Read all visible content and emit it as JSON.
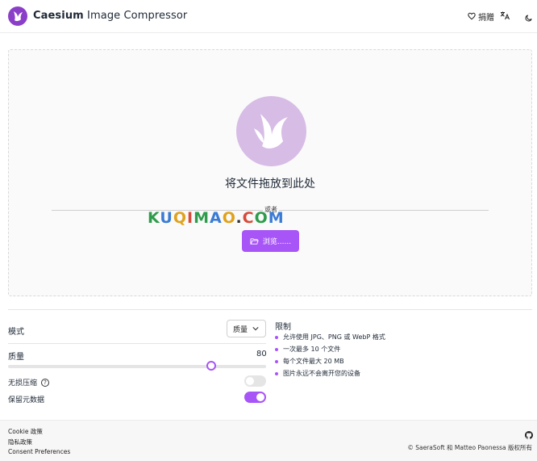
{
  "header": {
    "app_name_bold": "Caesium",
    "app_name_rest": " Image Compressor",
    "logo_icon": "caesium-bird-logo",
    "donate_label": "捐赠",
    "language_icon": "translate-icon",
    "theme_icon": "moon-icon"
  },
  "dropzone": {
    "title": "将文件拖放到此处",
    "or_text": "或者",
    "browse_label": "浏览......",
    "watermark": "KUQIMAO.COM"
  },
  "settings": {
    "mode_label": "模式",
    "mode_value": "质量",
    "quality_label": "质量",
    "quality_value": 80,
    "quality_value_text": "80",
    "lossless_label": "无损压缩",
    "lossless_enabled": false,
    "keep_metadata_label": "保留元数据",
    "keep_metadata_enabled": true
  },
  "limits": {
    "title": "限制",
    "items": [
      "允许使用 JPG、PNG 或 WebP 格式",
      "一次最多 10 个文件",
      "每个文件最大 20 MB",
      "图片永远不会离开您的设备"
    ]
  },
  "footer": {
    "cookie_policy": "Cookie 政策",
    "privacy_policy": "隐私政策",
    "consent_preferences": "Consent Preferences",
    "copyright": "© SaeraSoft 和 Matteo Paonessa 版权所有",
    "github_icon": "github-icon"
  },
  "colors": {
    "accent": "#a855f7",
    "logo": "#8b3fc9",
    "drop_circle": "#d7bce6"
  }
}
